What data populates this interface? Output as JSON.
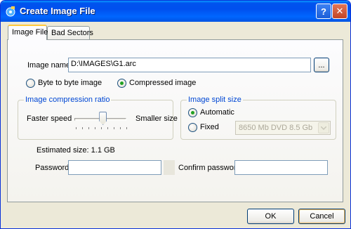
{
  "window": {
    "title": "Create Image File",
    "help_symbol": "?",
    "close_symbol": "✕"
  },
  "tabs": [
    {
      "label": "Image File",
      "active": true
    },
    {
      "label": "Bad Sectors",
      "active": false
    }
  ],
  "image_name": {
    "label": "Image name:",
    "value": "D:\\IMAGES\\G1.arc",
    "browse_label": "..."
  },
  "image_mode": {
    "options": [
      {
        "label": "Byte to byte image",
        "checked": false
      },
      {
        "label": "Compressed image",
        "checked": true
      }
    ]
  },
  "compression": {
    "group_title": "Image compression ratio",
    "left_label": "Faster speed",
    "right_label": "Smaller size",
    "level_fraction": 0.55
  },
  "split": {
    "group_title": "Image split size",
    "automatic_label": "Automatic",
    "automatic_checked": true,
    "fixed_label": "Fixed",
    "fixed_checked": false,
    "size_value": "8650 Mb  DVD 8.5 Gb",
    "size_disabled": true
  },
  "estimated_size": "Estimated size: 1.1 GB",
  "password": {
    "label": "Password:",
    "value": "",
    "confirm_label": "Confirm password:",
    "confirm_value": ""
  },
  "buttons": {
    "ok": "OK",
    "cancel": "Cancel"
  },
  "colors": {
    "title_bar": "#0054e3",
    "group_title": "#0046d5",
    "dialog_bg": "#ece9d8",
    "radio_dot": "#21a121",
    "tab_highlight": "#ffc83c"
  }
}
